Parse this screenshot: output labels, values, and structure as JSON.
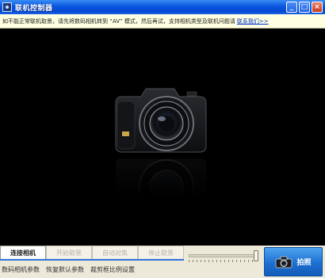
{
  "window": {
    "title": "联机控制器",
    "buttons": {
      "minimize": "_",
      "maximize": "□",
      "close": "×"
    }
  },
  "notice": {
    "text": "如不能正常联机取景，请先将数码相机转到 “AV” 模式，然后再试，支持相机类型及联机问题请",
    "link": "联系我们>>"
  },
  "tabs": [
    {
      "label": "连接相机",
      "active": true
    },
    {
      "label": "开始取景",
      "active": false
    },
    {
      "label": "自动对焦",
      "active": false
    },
    {
      "label": "停止取景",
      "active": false
    }
  ],
  "links": [
    {
      "label": "数码相机参数"
    },
    {
      "label": "恢复默认参数"
    },
    {
      "label": "裁剪框比例设置"
    }
  ],
  "slider": {
    "value": 1.0
  },
  "shoot_button": {
    "label": "拍照",
    "icon": "camera-icon"
  },
  "colors": {
    "accent": "#1d6fd2",
    "title_bar": "#0a55e0",
    "notice_bg": "#ffffe1",
    "link": "#0033cc"
  }
}
